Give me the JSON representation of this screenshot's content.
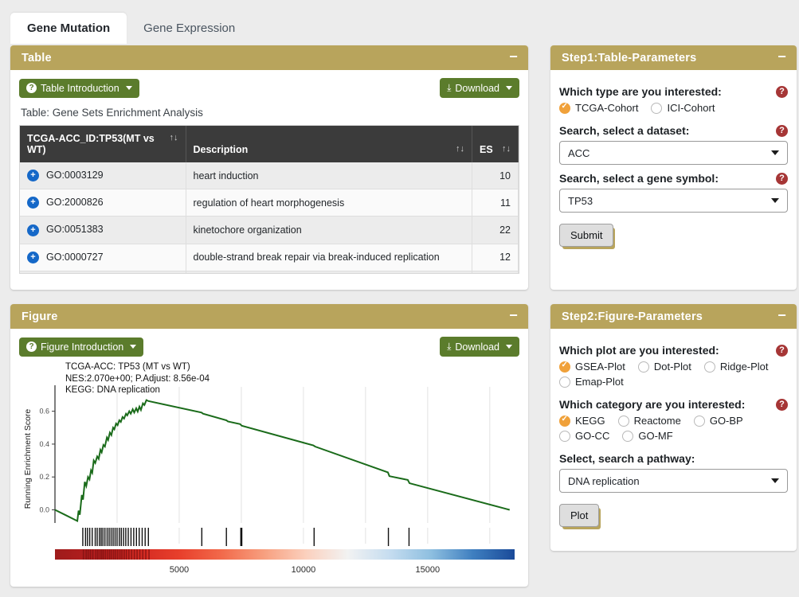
{
  "tabs": [
    {
      "label": "Gene Mutation",
      "active": true
    },
    {
      "label": "Gene Expression",
      "active": false
    }
  ],
  "table_panel": {
    "title": "Table",
    "minimize": "−",
    "intro_button": "Table Introduction",
    "download_button": "Download",
    "caption": "Table: Gene Sets Enrichment Analysis",
    "columns": [
      "TCGA-ACC_ID:TP53(MT vs WT)",
      "Description",
      "ES"
    ],
    "sort_glyph": "↑↓",
    "expand_glyph": "+",
    "rows": [
      {
        "id": "GO:0003129",
        "description": "heart induction",
        "es": "10"
      },
      {
        "id": "GO:2000826",
        "description": "regulation of heart morphogenesis",
        "es": "11"
      },
      {
        "id": "GO:0051383",
        "description": "kinetochore organization",
        "es": "22"
      },
      {
        "id": "GO:0000727",
        "description": "double-strand break repair via break-induced replication",
        "es": "12"
      }
    ]
  },
  "figure_panel": {
    "title": "Figure",
    "minimize": "−",
    "intro_button": "Figure Introduction",
    "download_button": "Download"
  },
  "step1": {
    "title": "Step1:Table-Parameters",
    "minimize": "−",
    "type_label": "Which type are you interested:",
    "type_options": [
      {
        "label": "TCGA-Cohort",
        "checked": true
      },
      {
        "label": "ICI-Cohort",
        "checked": false
      }
    ],
    "dataset_label": "Search, select a dataset:",
    "dataset_value": "ACC",
    "gene_label": "Search, select a gene symbol:",
    "gene_value": "TP53",
    "submit_label": "Submit",
    "help_glyph": "?"
  },
  "step2": {
    "title": "Step2:Figure-Parameters",
    "minimize": "−",
    "plot_label": "Which plot are you interested:",
    "plot_options": [
      {
        "label": "GSEA-Plot",
        "checked": true
      },
      {
        "label": "Dot-Plot",
        "checked": false
      },
      {
        "label": "Ridge-Plot",
        "checked": false
      },
      {
        "label": "Emap-Plot",
        "checked": false
      }
    ],
    "category_label": "Which category are you interested:",
    "category_options": [
      {
        "label": "KEGG",
        "checked": true
      },
      {
        "label": "Reactome",
        "checked": false
      },
      {
        "label": "GO-BP",
        "checked": false
      },
      {
        "label": "GO-CC",
        "checked": false
      },
      {
        "label": "GO-MF",
        "checked": false
      }
    ],
    "pathway_label": "Select, search a pathway:",
    "pathway_value": "DNA replication",
    "plot_button": "Plot",
    "help_glyph": "?"
  },
  "chart_data": {
    "type": "line",
    "title": "TCGA-ACC: TP53 (MT vs WT)\nNES:2.070e+00; P.Adjust: 8.56e-04\nKEGG: DNA replication",
    "title_lines": [
      "TCGA-ACC: TP53 (MT vs WT)",
      "NES:2.070e+00; P.Adjust: 8.56e-04",
      "KEGG: DNA replication"
    ],
    "nes": "2.070e+00",
    "p_adjust": "8.56e-04",
    "category": "KEGG",
    "pathway": "DNA replication",
    "cohort": "TCGA-ACC",
    "gene": "TP53",
    "comparison": "MT vs WT",
    "ylabel": "Running Enrichment Score",
    "xlabel": "",
    "ylim": [
      -0.08,
      0.7
    ],
    "xlim": [
      0,
      18500
    ],
    "yticks": [
      0.0,
      0.2,
      0.4,
      0.6
    ],
    "ytick_labels": [
      "0.0",
      "0.2",
      "0.4",
      "0.6"
    ],
    "xticks": [
      5000,
      10000,
      15000
    ],
    "xtick_labels": [
      "5000",
      "10000",
      "15000"
    ],
    "grid": "vertical-only",
    "legend": "none",
    "line_color": "#1a6b1a",
    "series": [
      {
        "name": "Running Enrichment Score",
        "points": [
          [
            0,
            0.0
          ],
          [
            400,
            -0.03
          ],
          [
            900,
            -0.068
          ],
          [
            950,
            -0.005
          ],
          [
            1000,
            -0.03
          ],
          [
            1080,
            0.09
          ],
          [
            1130,
            0.062
          ],
          [
            1200,
            0.17
          ],
          [
            1260,
            0.145
          ],
          [
            1330,
            0.2
          ],
          [
            1390,
            0.185
          ],
          [
            1450,
            0.24
          ],
          [
            1500,
            0.225
          ],
          [
            1560,
            0.3
          ],
          [
            1620,
            0.285
          ],
          [
            1700,
            0.325
          ],
          [
            1760,
            0.31
          ],
          [
            1830,
            0.365
          ],
          [
            1880,
            0.35
          ],
          [
            1950,
            0.395
          ],
          [
            2010,
            0.385
          ],
          [
            2090,
            0.44
          ],
          [
            2140,
            0.425
          ],
          [
            2210,
            0.47
          ],
          [
            2270,
            0.455
          ],
          [
            2340,
            0.5
          ],
          [
            2390,
            0.49
          ],
          [
            2460,
            0.525
          ],
          [
            2520,
            0.515
          ],
          [
            2590,
            0.545
          ],
          [
            2650,
            0.535
          ],
          [
            2720,
            0.565
          ],
          [
            2780,
            0.555
          ],
          [
            2860,
            0.585
          ],
          [
            2910,
            0.575
          ],
          [
            2990,
            0.6
          ],
          [
            3050,
            0.585
          ],
          [
            3130,
            0.612
          ],
          [
            3190,
            0.592
          ],
          [
            3270,
            0.618
          ],
          [
            3330,
            0.598
          ],
          [
            3400,
            0.628
          ],
          [
            3460,
            0.608
          ],
          [
            3540,
            0.648
          ],
          [
            3600,
            0.638
          ],
          [
            3680,
            0.668
          ],
          [
            3760,
            0.662
          ],
          [
            5900,
            0.592
          ],
          [
            5960,
            0.585
          ],
          [
            6900,
            0.545
          ],
          [
            6960,
            0.538
          ],
          [
            7450,
            0.522
          ],
          [
            7520,
            0.512
          ],
          [
            10400,
            0.392
          ],
          [
            10470,
            0.385
          ],
          [
            13400,
            0.228
          ],
          [
            13460,
            0.205
          ],
          [
            14200,
            0.182
          ],
          [
            14270,
            0.162
          ],
          [
            18300,
            0.0
          ]
        ]
      }
    ],
    "rug_ticks": [
      1120,
      1230,
      1310,
      1400,
      1500,
      1620,
      1700,
      1790,
      1860,
      1930,
      2010,
      2100,
      2180,
      2260,
      2340,
      2420,
      2500,
      2590,
      2670,
      2760,
      2850,
      2950,
      3060,
      3170,
      3280,
      3390,
      3510,
      3630,
      3760,
      5910,
      6900,
      7480,
      7520,
      10430,
      13420,
      14250
    ],
    "colorbar": {
      "description": "ranked-list metric color strip from dark red (high) through white to dark blue (low)",
      "stops": [
        "#9e1b1b",
        "#b71f1f",
        "#d42a22",
        "#e8402c",
        "#f26a4b",
        "#f79f7f",
        "#fbd0bd",
        "#f2f2f2",
        "#c6ddf0",
        "#8ebfe0",
        "#3f7fc0",
        "#1a4a99"
      ]
    }
  }
}
